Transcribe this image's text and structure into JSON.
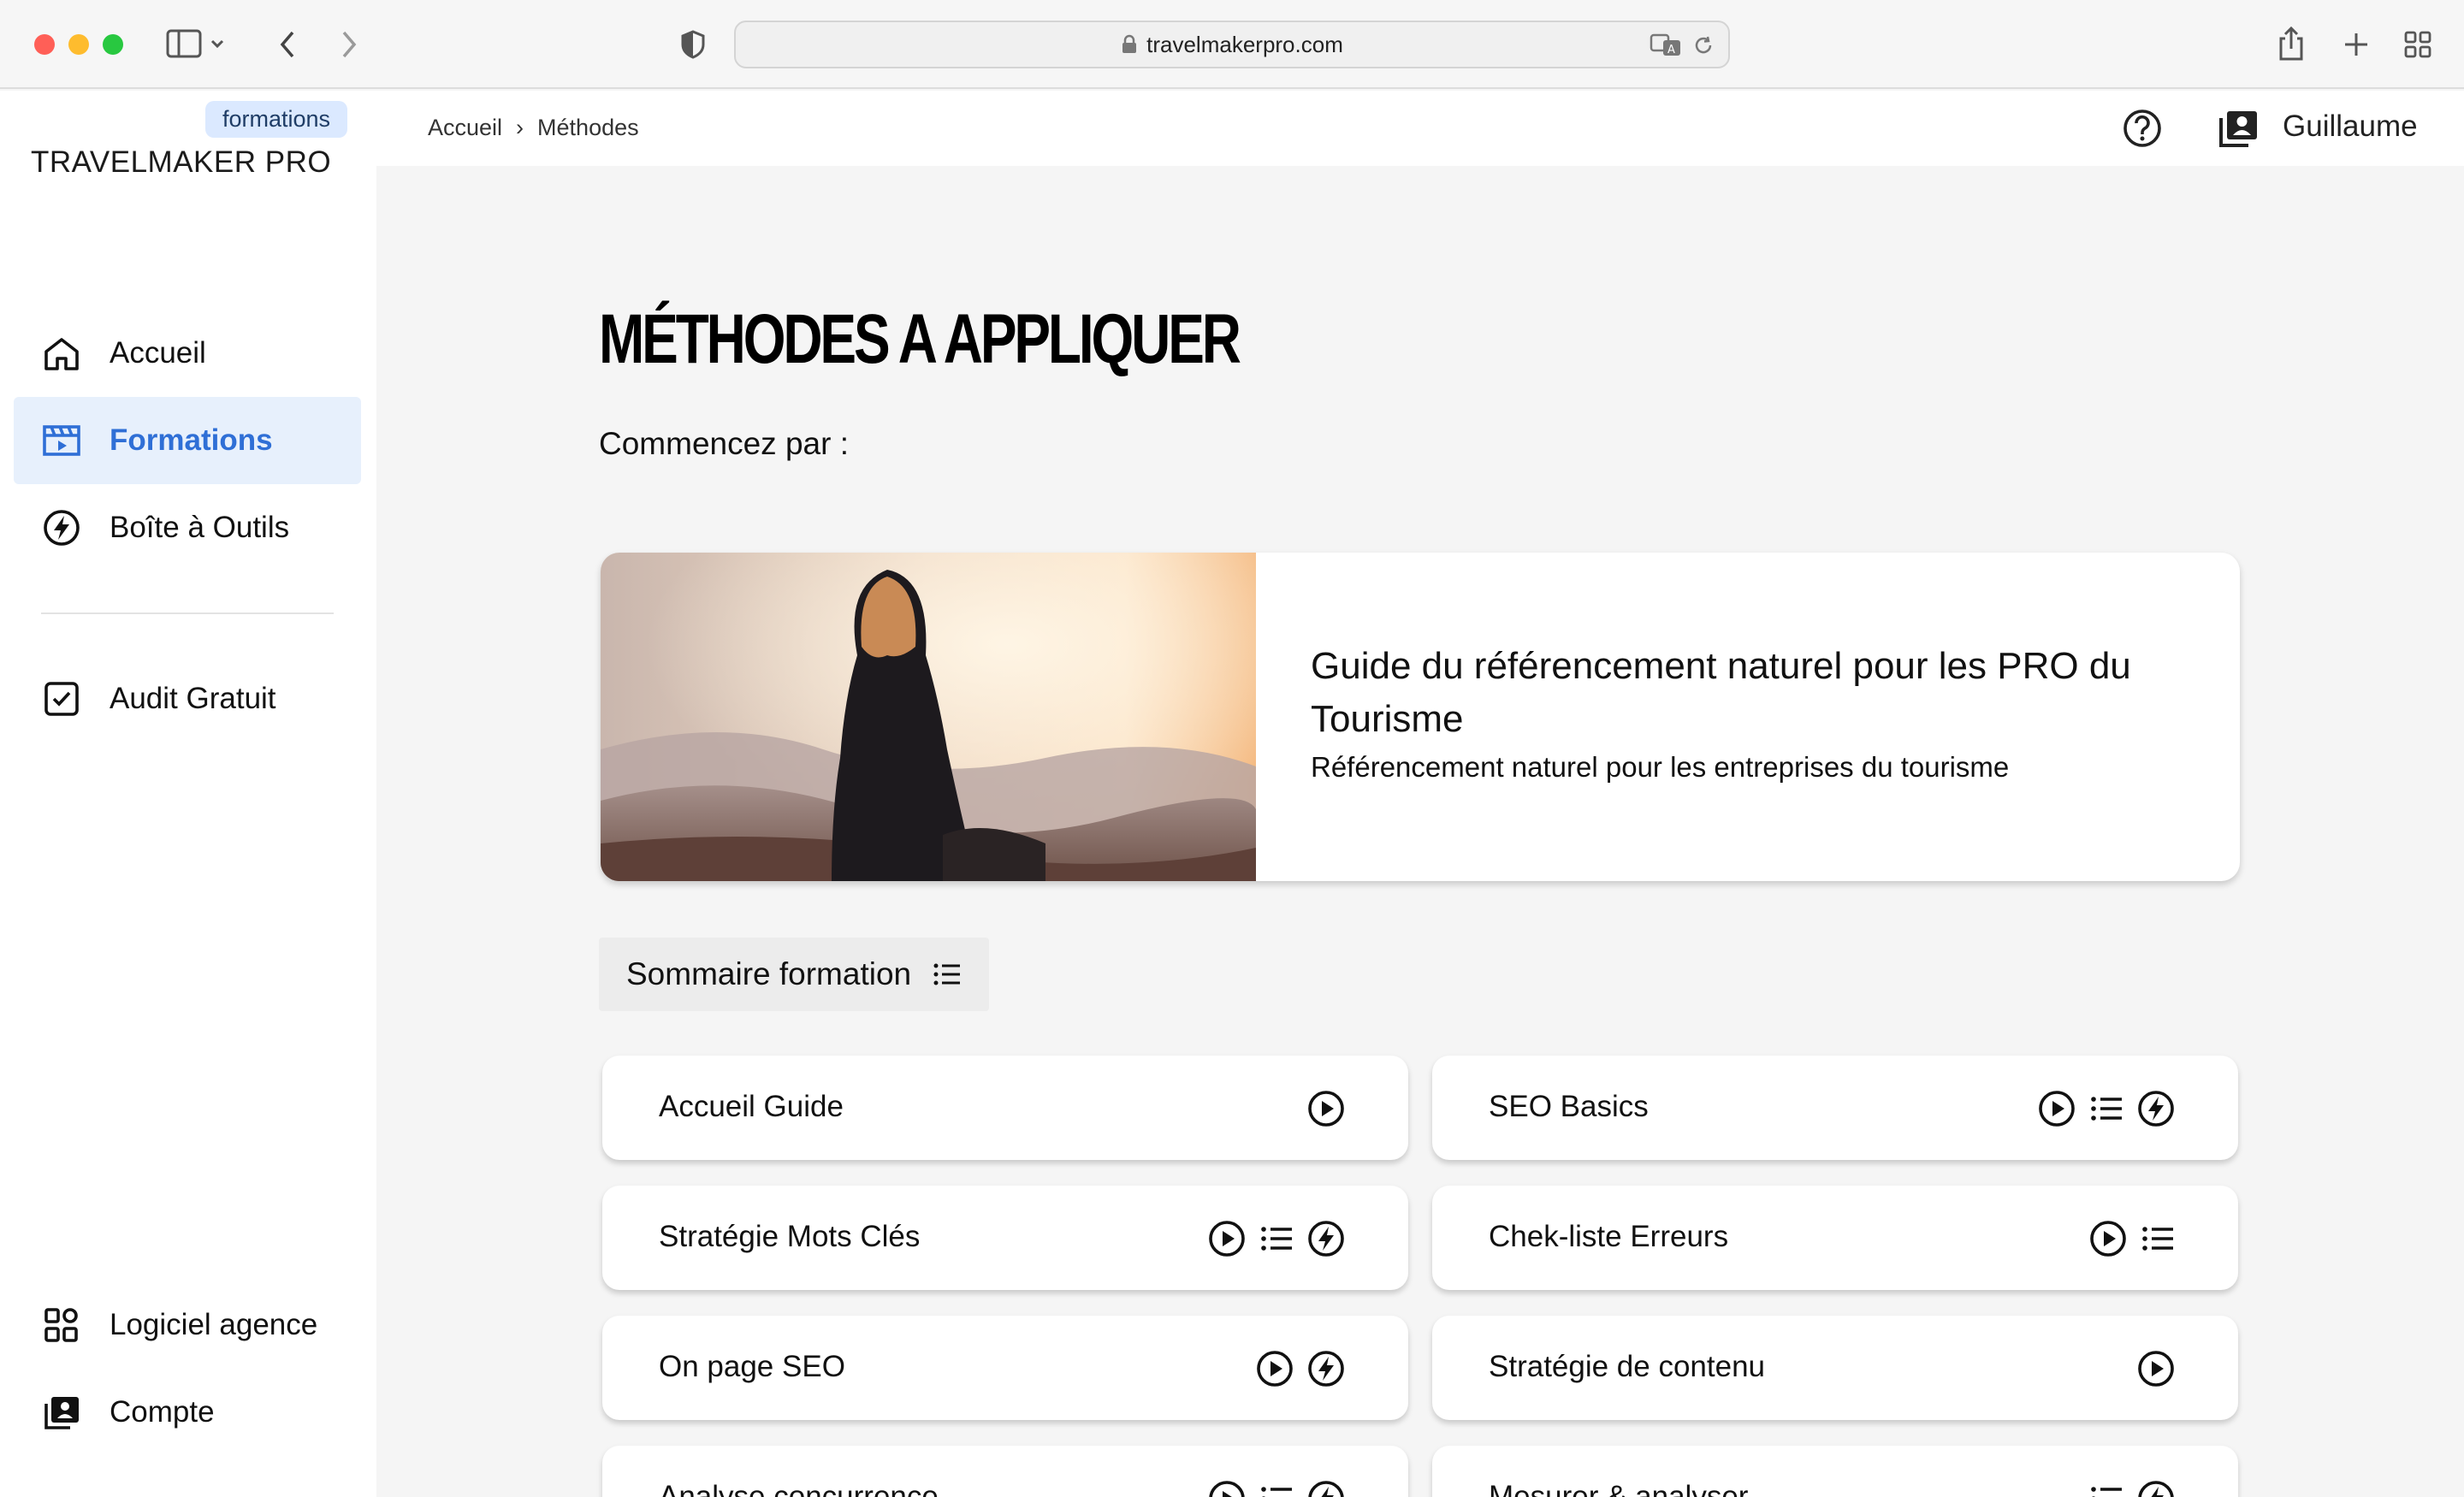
{
  "browser": {
    "url": "travelmakerpro.com",
    "traffic_colors": {
      "close": "#ff5f57",
      "minimize": "#febc2e",
      "zoom": "#28c840"
    }
  },
  "sidebar": {
    "badge": "formations",
    "brand": "TRAVELMAKER PRO",
    "accent": "#2f6fd6",
    "items": [
      {
        "label": "Accueil",
        "icon": "home-icon"
      },
      {
        "label": "Formations",
        "icon": "clapperboard-icon",
        "active": true
      },
      {
        "label": "Boîte à Outils",
        "icon": "bolt-circle-icon"
      },
      {
        "label": "Audit Gratuit",
        "icon": "check-square-icon"
      }
    ],
    "bottom_items": [
      {
        "label": "Logiciel agence",
        "icon": "apps-grid-icon"
      },
      {
        "label": "Compte",
        "icon": "account-box-icon"
      }
    ]
  },
  "topbar": {
    "breadcrumb": [
      "Accueil",
      "Méthodes"
    ],
    "user": "Guillaume"
  },
  "main": {
    "title": "MÉTHODES A APPLIQUER",
    "intro": "Commencez par :",
    "hero": {
      "title": "Guide du référencement naturel pour les PRO du Tourisme",
      "subtitle": "Référencement naturel pour les entreprises du tourisme"
    },
    "summary_button": "Sommaire formation",
    "modules": [
      {
        "label": "Accueil Guide",
        "icons": [
          "play-circle-icon"
        ]
      },
      {
        "label": "SEO Basics",
        "icons": [
          "play-circle-icon",
          "list-icon",
          "bolt-circle-icon"
        ]
      },
      {
        "label": "Stratégie Mots Clés",
        "icons": [
          "play-circle-icon",
          "list-icon",
          "bolt-circle-icon"
        ]
      },
      {
        "label": "Chek-liste Erreurs",
        "icons": [
          "play-circle-icon",
          "list-icon"
        ]
      },
      {
        "label": "On page SEO",
        "icons": [
          "play-circle-icon",
          "bolt-circle-icon"
        ]
      },
      {
        "label": "Stratégie de contenu",
        "icons": [
          "play-circle-icon"
        ]
      },
      {
        "label": "Analyse concurrence",
        "icons": [
          "play-circle-icon",
          "list-icon",
          "bolt-circle-icon"
        ]
      },
      {
        "label": "Mesurer & analyser",
        "icons": [
          "list-icon",
          "bolt-circle-icon"
        ]
      }
    ]
  }
}
